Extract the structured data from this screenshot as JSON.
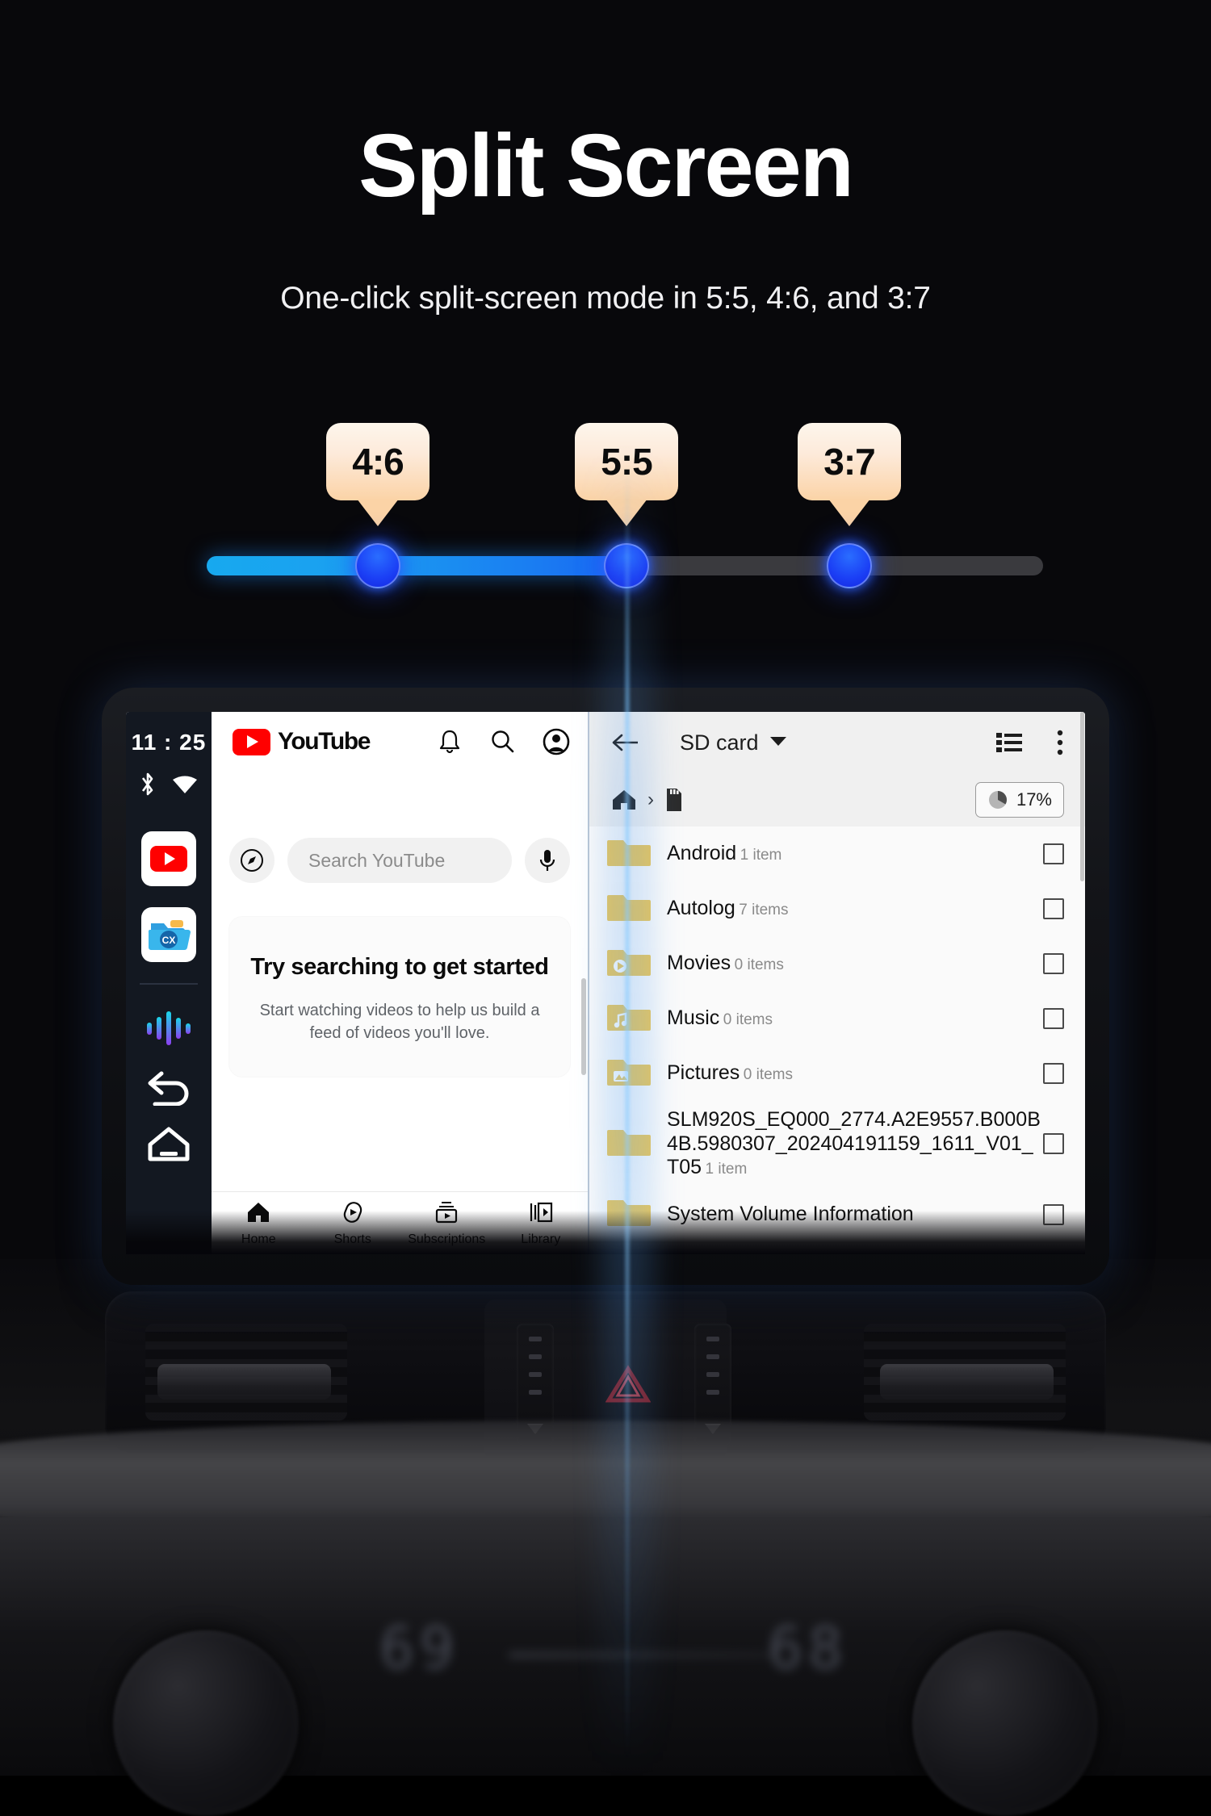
{
  "hero": {
    "title": "Split Screen",
    "subtitle": "One-click split-screen mode in 5:5, 4:6, and 3:7"
  },
  "ratio_slider": {
    "badges": [
      {
        "label": "4:6",
        "x_pct": 20.5
      },
      {
        "label": "5:5",
        "x_pct": 50.2
      },
      {
        "label": "3:7",
        "x_pct": 76.8
      }
    ],
    "handles": [
      {
        "label": "4:6",
        "x_pct": 20.5
      },
      {
        "label": "5:5",
        "x_pct": 50.2
      },
      {
        "label": "3:7",
        "x_pct": 76.8
      }
    ],
    "fill_pct": 50.2,
    "track_color": "#3a3a3e",
    "fill_color_start": "#17a9ef",
    "fill_color_end": "#1866f3",
    "handle_color": "#1b3ff5",
    "badge_color_start": "#fdf6ec",
    "badge_color_end": "#fbd3a6"
  },
  "headunit": {
    "sidebar": {
      "clock": "11 : 25",
      "status_icons": [
        "bluetooth-icon",
        "wifi-icon"
      ],
      "apps": [
        "youtube-app-icon",
        "cx-file-explorer-app-icon"
      ],
      "buttons": [
        "equalizer-icon",
        "back-icon",
        "home-icon"
      ]
    },
    "youtube": {
      "brand": "YouTube",
      "top_actions": [
        "bell-icon",
        "search-icon",
        "account-icon"
      ],
      "search_placeholder": "Search YouTube",
      "voice_icon": "microphone-icon",
      "explore_icon": "compass-icon",
      "empty_state": {
        "title": "Try searching to get started",
        "body": "Start watching videos to help us build a feed of videos you'll love."
      },
      "nav": [
        {
          "label": "Home",
          "icon": "home-icon",
          "active": true
        },
        {
          "label": "Shorts",
          "icon": "shorts-icon",
          "active": false
        },
        {
          "label": "Subscriptions",
          "icon": "subscriptions-icon",
          "active": false
        },
        {
          "label": "Library",
          "icon": "library-icon",
          "active": false
        }
      ]
    },
    "filemanager": {
      "back_icon": "back-arrow-icon",
      "title": "SD card",
      "dropdown_icon": "caret-down-icon",
      "view_icon": "list-view-icon",
      "overflow_icon": "more-vertical-icon",
      "breadcrumb": [
        "home-icon",
        "sd-card-icon"
      ],
      "breadcrumb_separator": "›",
      "storage_usage": "17%",
      "storage_icon": "pie-chart-icon",
      "items": [
        {
          "name": "Android",
          "sub": "1 item",
          "icon": "folder-plain-icon"
        },
        {
          "name": "Autolog",
          "sub": "7 items",
          "icon": "folder-plain-icon"
        },
        {
          "name": "Movies",
          "sub": "0 items",
          "icon": "folder-movies-icon"
        },
        {
          "name": "Music",
          "sub": "0 items",
          "icon": "folder-music-icon"
        },
        {
          "name": "Pictures",
          "sub": "0 items",
          "icon": "folder-pictures-icon"
        },
        {
          "name": "SLM920S_EQ000_2774.A2E9557.B000B4B.5980307_202404191159_1611_V01_T05",
          "sub": "1 item",
          "icon": "folder-plain-icon"
        },
        {
          "name": "System Volume Information",
          "sub": "",
          "icon": "folder-plain-icon"
        }
      ]
    }
  },
  "dashboard": {
    "climate_left": "69",
    "climate_right": "68",
    "hazard_icon": "hazard-triangle-icon"
  }
}
